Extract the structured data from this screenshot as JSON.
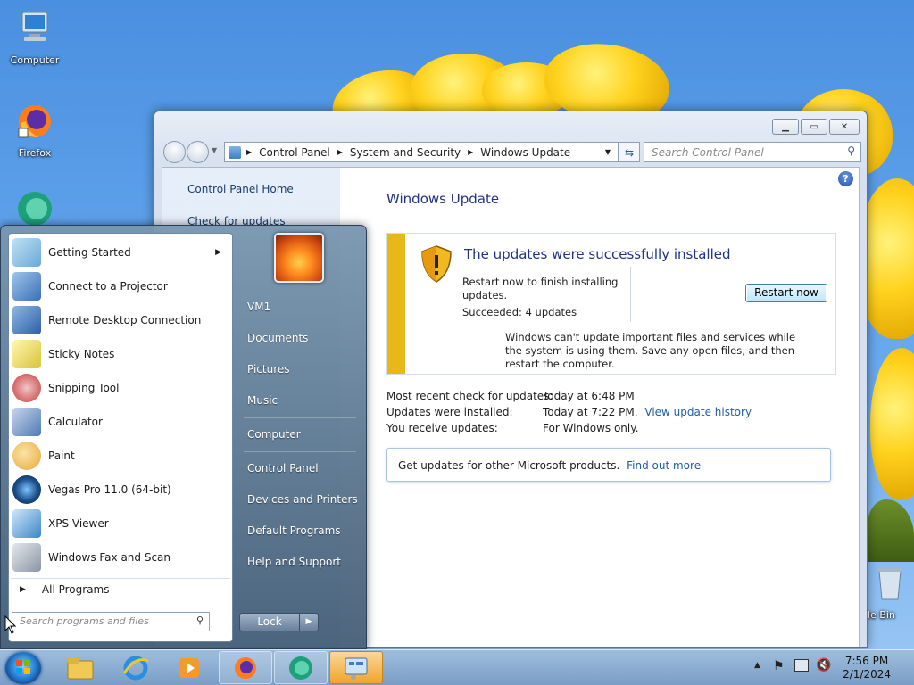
{
  "desktop": {
    "icons": [
      {
        "label": "Computer"
      },
      {
        "label": "Firefox"
      },
      {
        "label": "cle Bin"
      }
    ]
  },
  "window": {
    "breadcrumb": [
      "Control Panel",
      "System and Security",
      "Windows Update"
    ],
    "search_placeholder": "Search Control Panel",
    "left_links": [
      "Control Panel Home",
      "Check for updates"
    ],
    "title": "Windows Update",
    "status": {
      "title": "The updates were successfully installed",
      "restart_text": "Restart now to finish installing updates.",
      "succeeded": "Succeeded: 4 updates",
      "restart_button": "Restart now",
      "warning": "Windows can't update important files and services while the system is using them. Save any open files, and then restart the computer."
    },
    "info": {
      "recent_label": "Most recent check for updates:",
      "recent_value": "Today at 6:48 PM",
      "installed_label": "Updates were installed:",
      "installed_value": "Today at 7:22 PM.",
      "history_link": "View update history",
      "receive_label": "You receive updates:",
      "receive_value": "For Windows only."
    },
    "get_updates": {
      "text": "Get updates for other Microsoft products.",
      "link": "Find out more"
    }
  },
  "start_menu": {
    "programs": [
      {
        "label": "Getting Started",
        "color": "#6aa9d8"
      },
      {
        "label": "Connect to a Projector",
        "color": "#3a6fb8"
      },
      {
        "label": "Remote Desktop Connection",
        "color": "#2d5ea8"
      },
      {
        "label": "Sticky Notes",
        "color": "#f3e36a"
      },
      {
        "label": "Snipping Tool",
        "color": "#c43a3a"
      },
      {
        "label": "Calculator",
        "color": "#4f79b5"
      },
      {
        "label": "Paint",
        "color": "#e8a83a"
      },
      {
        "label": "Vegas Pro 11.0 (64-bit)",
        "color": "#1b4f8a"
      },
      {
        "label": "XPS Viewer",
        "color": "#3b86c8"
      },
      {
        "label": "Windows Fax and Scan",
        "color": "#8a96a4"
      }
    ],
    "all_programs": "All Programs",
    "search_placeholder": "Search programs and files",
    "right_links": [
      "VM1",
      "Documents",
      "Pictures",
      "Music",
      "Computer",
      "Control Panel",
      "Devices and Printers",
      "Default Programs",
      "Help and Support"
    ],
    "lock_label": "Lock"
  },
  "taskbar": {
    "time": "7:56 PM",
    "date": "2/1/2024"
  },
  "colors": {
    "accent": "#1e3287",
    "link": "#1f5da8",
    "status_bar": "#e8b81a"
  }
}
